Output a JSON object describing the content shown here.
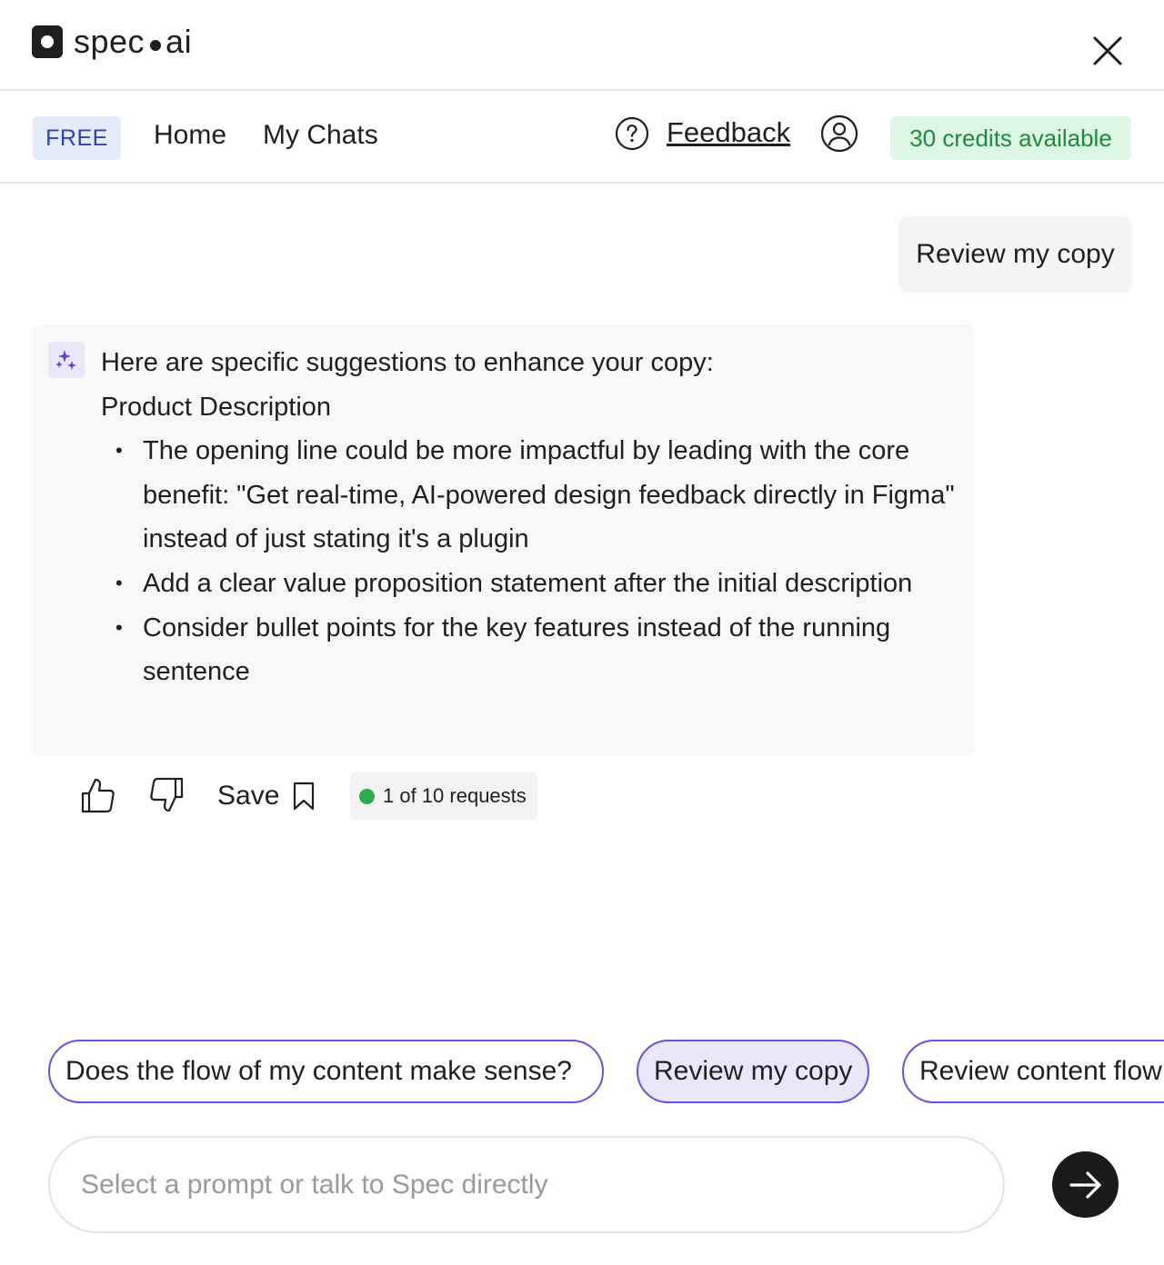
{
  "header": {
    "logo_left": "spec",
    "logo_right": "ai",
    "close_icon": "close-icon"
  },
  "nav": {
    "plan_badge": "FREE",
    "home": "Home",
    "my_chats": "My Chats",
    "feedback": "Feedback",
    "credits": "30 credits available"
  },
  "chat": {
    "user_message": "Review my copy",
    "ai_intro": "Here are specific suggestions to enhance your copy:",
    "ai_section": "Product Description",
    "ai_bullets": [
      "The opening line could be more impactful by leading with the core benefit: \"Get real-time, AI-powered design feedback directly in Figma\" instead of just stating it's a plugin",
      "Add a clear value proposition statement after the initial description",
      "Consider bullet points for the key features instead of the running sentence"
    ]
  },
  "actions": {
    "save_label": "Save",
    "requests": "1 of 10 requests"
  },
  "prompts": [
    "Does the flow of my content make sense?",
    "Review my copy",
    "Review content flow"
  ],
  "input": {
    "placeholder": "Select a prompt or talk to Spec directly",
    "value": ""
  },
  "colors": {
    "accent_purple": "#6b4fe0",
    "chip_selected_bg": "#ebe7fb",
    "free_badge_bg": "#e4ebfb",
    "free_badge_text": "#2b45b8",
    "credits_bg": "#dcf7e3",
    "credits_text": "#1f8a3c",
    "status_dot": "#2eaa4f"
  },
  "icons": [
    "close-icon",
    "help-icon",
    "user-icon",
    "sparkle-icon",
    "thumbs-up-icon",
    "thumbs-down-icon",
    "bookmark-icon",
    "arrow-right-icon"
  ]
}
